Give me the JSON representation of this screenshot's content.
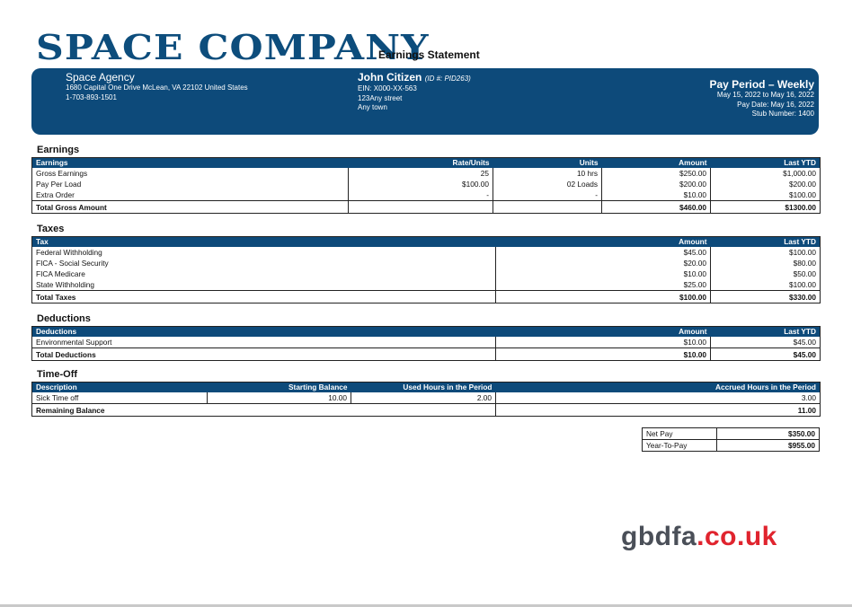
{
  "header": {
    "logo": "SPACE COMPANY",
    "doc_title": "Earnings Statement"
  },
  "employer": {
    "name": "Space Agency",
    "address": "1680 Capital One Drive McLean, VA 22102 United States",
    "phone": "1-703-893-1501"
  },
  "employee": {
    "name": "John Citizen",
    "id": "(ID #: PID263)",
    "ein": "EIN: X000-XX-563",
    "street": "123Any street",
    "city": "Any town"
  },
  "pay_period": {
    "title": "Pay Period – Weekly",
    "range": "May 15, 2022 to May 16, 2022",
    "pay_date": "Pay Date: May 16, 2022",
    "stub": "Stub Number: 1400"
  },
  "earnings": {
    "title": "Earnings",
    "headers": [
      "Earnings",
      "Rate/Units",
      "Units",
      "Amount",
      "Last YTD"
    ],
    "rows": [
      [
        "Gross Earnings",
        "25",
        "10 hrs",
        "$250.00",
        "$1,000.00"
      ],
      [
        "Pay Per Load",
        "$100.00",
        "02 Loads",
        "$200.00",
        "$200.00"
      ],
      [
        "Extra Order",
        "-",
        "-",
        "$10.00",
        "$100.00"
      ]
    ],
    "total": [
      "Total Gross Amount",
      "",
      "",
      "$460.00",
      "$1300.00"
    ]
  },
  "taxes": {
    "title": "Taxes",
    "headers": [
      "Tax",
      "Amount",
      "Last YTD"
    ],
    "rows": [
      [
        "Federal Withholding",
        "$45.00",
        "$100.00"
      ],
      [
        "FICA - Social Security",
        "$20.00",
        "$80.00"
      ],
      [
        "FICA Medicare",
        "$10.00",
        "$50.00"
      ],
      [
        "State Withholding",
        "$25.00",
        "$100.00"
      ]
    ],
    "total": [
      "Total Taxes",
      "$100.00",
      "$330.00"
    ]
  },
  "deductions": {
    "title": "Deductions",
    "headers": [
      "Deductions",
      "Amount",
      "Last YTD"
    ],
    "rows": [
      [
        "Environmental Support",
        "$10.00",
        "$45.00"
      ]
    ],
    "total": [
      "Total Deductions",
      "$10.00",
      "$45.00"
    ]
  },
  "timeoff": {
    "title": "Time-Off",
    "headers": [
      "Description",
      "Starting Balance",
      "Used Hours in the Period",
      "Accrued Hours in the Period"
    ],
    "rows": [
      [
        "Sick Time off",
        "10.00",
        "2.00",
        "3.00"
      ]
    ],
    "total": [
      "Remaining Balance",
      "11.00"
    ]
  },
  "net": {
    "net_pay_label": "Net Pay",
    "net_pay": "$350.00",
    "ytp_label": "Year-To-Pay",
    "ytp": "$955.00"
  },
  "brand": {
    "part1": "gbdfa",
    "part2": ".co.uk"
  },
  "colors": {
    "primary": "#0d4a7a",
    "brand_red": "#e0242e",
    "brand_gray": "#4a4f58"
  }
}
